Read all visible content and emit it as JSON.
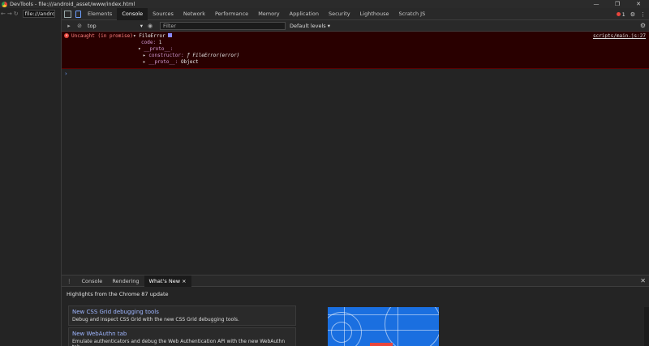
{
  "window": {
    "title": "DevTools - file:///android_asset/www/index.html",
    "controls": [
      "—",
      "❐",
      "✕"
    ]
  },
  "left_pane": {
    "url": "file:///andro"
  },
  "tabs": [
    "Elements",
    "Console",
    "Sources",
    "Network",
    "Performance",
    "Memory",
    "Application",
    "Security",
    "Lighthouse",
    "Scratch JS"
  ],
  "active_tab": "Console",
  "error_count": "1",
  "toolbar": {
    "context": "top",
    "filter_placeholder": "Filter",
    "levels": "Default levels ▾"
  },
  "console": {
    "error_prefix": "Uncaught (in promise)",
    "error_type": "FileError",
    "code_label": "code:",
    "code_value": "1",
    "proto_label": "__proto__:",
    "constructor_label": "constructor:",
    "constructor_value": "ƒ FileError(error)",
    "inner_proto_label": "__proto__:",
    "inner_proto_value": "Object",
    "source_link": "scripts/main.js:27",
    "prompt": "›"
  },
  "drawer": {
    "tabs": [
      "Console",
      "Rendering",
      "What's New"
    ],
    "active_tab": "What's New",
    "highlights_title": "Highlights from the Chrome 87 update",
    "cards": [
      {
        "title": "New CSS Grid debugging tools",
        "desc": "Debug and inspect CSS Grid with the new CSS Grid debugging tools."
      },
      {
        "title": "New WebAuthn tab",
        "desc": "Emulate authenticators and debug the Web Authentication API with the new WebAuthn tab."
      }
    ]
  },
  "colors": {
    "error_bg": "#290000",
    "error_text": "#ff8080",
    "accent": "#1a6fe0"
  }
}
